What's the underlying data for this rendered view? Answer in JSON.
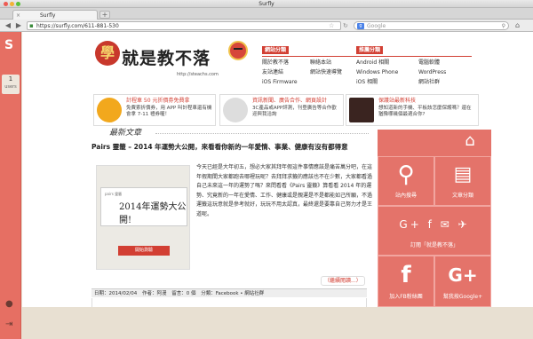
{
  "window": {
    "title": "Surfly"
  },
  "tabs": [
    {
      "label": "Surfly",
      "close": "×"
    }
  ],
  "newtab": "+",
  "nav": {
    "back": "◀",
    "forward": "▶",
    "reload": "C",
    "home": "⌂"
  },
  "address": {
    "url": "https://surfly.com/611-881-530",
    "lock": "🔒"
  },
  "search": {
    "placeholder": "Google",
    "engine": "g"
  },
  "surfly": {
    "logo": "S",
    "users_count": "1",
    "users_label": "users"
  },
  "site": {
    "logo_badge": "學",
    "logo_text": "就是教不落",
    "logo_url": "http://steachs.com",
    "menus": [
      {
        "heading": "網站分類",
        "items": [
          "關於教不落",
          "聯絡本站",
          "友站連結",
          "網站快速導覽",
          "iOS Firmware",
          ""
        ]
      },
      {
        "heading": "推薦分類",
        "items": [
          "Android 相關",
          "電腦軟體",
          "Windows Phone",
          "WordPress",
          "iOS 相關",
          "網站社群"
        ]
      }
    ],
    "promos": [
      {
        "title": "計程車 50 元折價券免費拿",
        "desc": "免費索折價券，用 APP 叫計程車還有機會拿 7-11 禮券喔！",
        "icon": "taxi-icon"
      },
      {
        "title": "資訊新聞、廣告合作、網頁設計",
        "desc": "3C產品或APP評測，刊登廣告等合作歡迎與我洽詢",
        "icon": "pen-icon"
      },
      {
        "title": "保護站最新科技",
        "desc": "想知道新的手機、平板該怎麼保護嗎？還在猶豫哪幾個最適合你?",
        "icon": "tech-icon"
      }
    ],
    "section_heading": "最新文章",
    "article": {
      "title": "Pairs 靈籤 – 2014 年運勢大公開，來看看你新的一年愛情、事業、健康有沒有都得意",
      "thumb_label": "pairs 靈籤",
      "thumb_title": "2014年運勢大公開!",
      "thumb_button": "開始測驗",
      "body": "今天已經是大年初五，想必大家其拜年假這件事情應該是痛苦萬分吧，在這年假期間大家都跑去哪裡玩呢？去拜拜求籤的應該也不在少數，大家都看過自己未來這一年的運勢了嗎？來問看看《Pairs 靈籤》算看看 2014 年的運勢、究竟新的一年在愛情、工作、健康或是親運是不是都能如己所願，不過運籤這玩意就是參考就好，玩玩不用太認真，最終還是要靠自己努力才是王道呢。",
      "readmore": "（繼續閱讀...）",
      "meta": {
        "date": "日期：2014/02/04",
        "author": "作者：阿漫",
        "comments": "留言：0 個",
        "category": "分類：Facebook • 網站社群"
      }
    },
    "tiles": [
      {
        "label": "",
        "icon": "home-icon"
      },
      {
        "label": "站內搜尋",
        "icon": "search-icon"
      },
      {
        "label": "文章分類",
        "icon": "document-icon"
      },
      {
        "label": "訂閱「就是教不落」",
        "icon": "subscribe-icon"
      },
      {
        "label": "加入FB粉絲團",
        "icon": "facebook-icon"
      },
      {
        "label": "幫我按Google+",
        "icon": "google-plus-icon"
      }
    ]
  },
  "colors": {
    "accent": "#d23f33",
    "tile": "#e4736a",
    "surfly": "#e66f63"
  }
}
